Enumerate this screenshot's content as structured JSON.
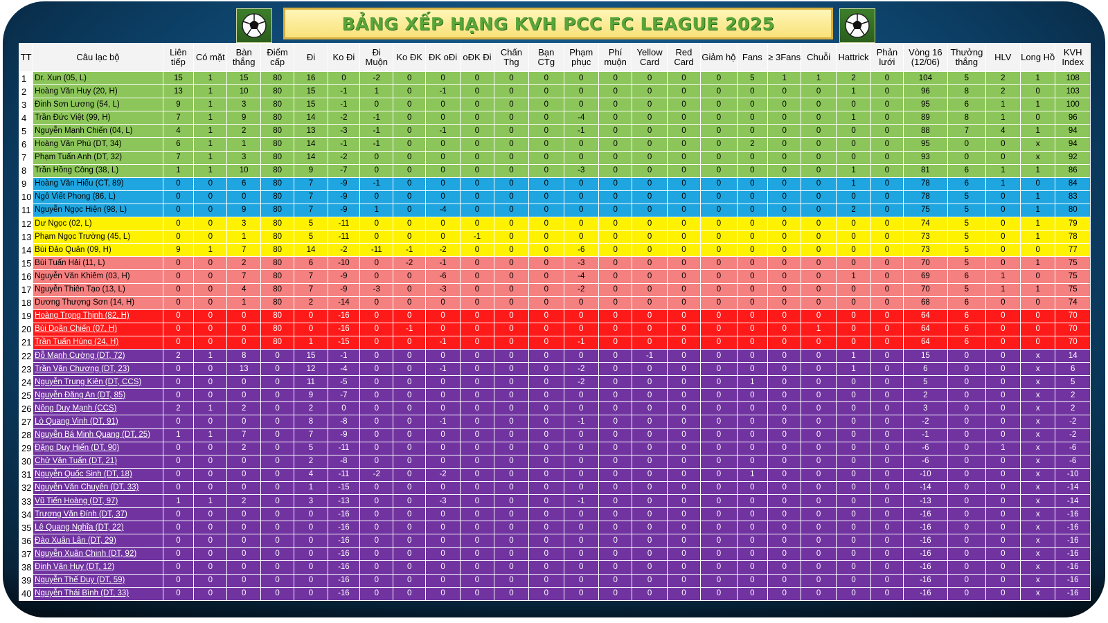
{
  "title": "BẢNG XẾP HẠNG KVH PCC FC LEAGUE 2025",
  "icons": {
    "left": "soccer-ball-icon",
    "right": "soccer-ball-icon"
  },
  "colors": {
    "green": "#8cc55a",
    "blue": "#1fa6e0",
    "yellow": "#fff200",
    "salmon": "#f58080",
    "red": "#ff1a1a",
    "purple": "#7033a0"
  },
  "headers": [
    "TT",
    "Câu lạc bộ",
    "Liên tiếp",
    "Có mặt",
    "Bàn thắng",
    "Điểm cấp",
    "Đi",
    "Ko Đi",
    "Đi Muộn",
    "Ko ĐK",
    "ĐK oĐi",
    "oĐK Đi",
    "Chấn Thg",
    "Bạn CTg",
    "Phạm phục",
    "Phí muộn",
    "Yellow Card",
    "Red Card",
    "Giảm hộ",
    "Fans",
    "≥ 3Fans",
    "Chuỗi",
    "Hattrick",
    "Phản lưới",
    "Vòng 16 (12/06)",
    "Thưởng thắng",
    "HLV",
    "Long Hồ",
    "KVH Index"
  ],
  "rows": [
    {
      "band": "g",
      "cells": [
        "1",
        "Dr. Xun (05, L)",
        "15",
        "1",
        "15",
        "80",
        "16",
        "0",
        "-2",
        "0",
        "0",
        "0",
        "0",
        "0",
        "0",
        "0",
        "0",
        "0",
        "0",
        "5",
        "1",
        "1",
        "2",
        "0",
        "104",
        "5",
        "2",
        "1",
        "108"
      ]
    },
    {
      "band": "g",
      "cells": [
        "2",
        "Hoàng Văn Huy (20, H)",
        "13",
        "1",
        "10",
        "80",
        "15",
        "-1",
        "1",
        "0",
        "-1",
        "0",
        "0",
        "0",
        "0",
        "0",
        "0",
        "0",
        "0",
        "0",
        "0",
        "0",
        "1",
        "0",
        "96",
        "8",
        "2",
        "0",
        "103"
      ]
    },
    {
      "band": "g",
      "cells": [
        "3",
        "Đinh Sơn Lương (54, L)",
        "9",
        "1",
        "3",
        "80",
        "15",
        "-1",
        "0",
        "0",
        "0",
        "0",
        "0",
        "0",
        "0",
        "0",
        "0",
        "0",
        "0",
        "0",
        "0",
        "0",
        "0",
        "0",
        "95",
        "6",
        "1",
        "1",
        "100"
      ]
    },
    {
      "band": "g",
      "cells": [
        "4",
        "Trần Đức Việt (99, H)",
        "7",
        "1",
        "9",
        "80",
        "14",
        "-2",
        "-1",
        "0",
        "0",
        "0",
        "0",
        "0",
        "-4",
        "0",
        "0",
        "0",
        "0",
        "0",
        "0",
        "0",
        "1",
        "0",
        "89",
        "8",
        "1",
        "0",
        "96"
      ]
    },
    {
      "band": "g",
      "cells": [
        "5",
        "Nguyễn Mạnh Chiến (04, L)",
        "4",
        "1",
        "2",
        "80",
        "13",
        "-3",
        "-1",
        "0",
        "-1",
        "0",
        "0",
        "0",
        "-1",
        "0",
        "0",
        "0",
        "0",
        "0",
        "0",
        "0",
        "0",
        "0",
        "88",
        "7",
        "4",
        "1",
        "94"
      ]
    },
    {
      "band": "g",
      "cells": [
        "6",
        "Hoàng Văn Phú (DT, 34)",
        "6",
        "1",
        "1",
        "80",
        "14",
        "-1",
        "-1",
        "0",
        "0",
        "0",
        "0",
        "0",
        "0",
        "0",
        "0",
        "0",
        "0",
        "2",
        "0",
        "0",
        "0",
        "0",
        "95",
        "0",
        "0",
        "x",
        "94"
      ]
    },
    {
      "band": "g",
      "cells": [
        "7",
        "Phạm Tuấn Anh (DT, 32)",
        "7",
        "1",
        "3",
        "80",
        "14",
        "-2",
        "0",
        "0",
        "0",
        "0",
        "0",
        "0",
        "0",
        "0",
        "0",
        "0",
        "0",
        "0",
        "0",
        "0",
        "0",
        "0",
        "93",
        "0",
        "0",
        "x",
        "92"
      ]
    },
    {
      "band": "g",
      "cells": [
        "8",
        "Trần Hồng Công (38, L)",
        "1",
        "1",
        "10",
        "80",
        "9",
        "-7",
        "0",
        "0",
        "0",
        "0",
        "0",
        "0",
        "-3",
        "0",
        "0",
        "0",
        "0",
        "0",
        "0",
        "0",
        "1",
        "0",
        "81",
        "6",
        "1",
        "1",
        "86"
      ]
    },
    {
      "band": "b",
      "cells": [
        "9",
        "Hoàng Văn Hiếu (CT, 89)",
        "0",
        "0",
        "6",
        "80",
        "7",
        "-9",
        "-1",
        "0",
        "0",
        "0",
        "0",
        "0",
        "0",
        "0",
        "0",
        "0",
        "0",
        "0",
        "0",
        "0",
        "1",
        "0",
        "78",
        "6",
        "1",
        "0",
        "84"
      ]
    },
    {
      "band": "b",
      "cells": [
        "10",
        "Ngô Viết Phong (86, L)",
        "0",
        "0",
        "0",
        "80",
        "7",
        "-9",
        "0",
        "0",
        "0",
        "0",
        "0",
        "0",
        "0",
        "0",
        "0",
        "0",
        "0",
        "0",
        "0",
        "0",
        "0",
        "0",
        "78",
        "5",
        "0",
        "1",
        "83"
      ]
    },
    {
      "band": "b",
      "cells": [
        "11",
        "Nguyễn Ngọc Hiện (98, L)",
        "0",
        "0",
        "9",
        "80",
        "7",
        "-9",
        "1",
        "0",
        "-4",
        "0",
        "0",
        "0",
        "0",
        "0",
        "0",
        "0",
        "0",
        "0",
        "0",
        "0",
        "2",
        "0",
        "75",
        "5",
        "0",
        "1",
        "80"
      ]
    },
    {
      "band": "y",
      "cells": [
        "12",
        "Dư Ngọc (02, L)",
        "0",
        "0",
        "3",
        "80",
        "5",
        "-11",
        "0",
        "0",
        "0",
        "0",
        "0",
        "0",
        "0",
        "0",
        "0",
        "0",
        "0",
        "0",
        "0",
        "0",
        "0",
        "0",
        "74",
        "5",
        "0",
        "1",
        "79"
      ]
    },
    {
      "band": "y",
      "cells": [
        "13",
        "Phạm Ngọc Trường (45, L)",
        "0",
        "0",
        "1",
        "80",
        "5",
        "-11",
        "0",
        "0",
        "0",
        "-1",
        "0",
        "0",
        "0",
        "0",
        "0",
        "0",
        "0",
        "0",
        "0",
        "0",
        "0",
        "0",
        "73",
        "5",
        "0",
        "1",
        "78"
      ]
    },
    {
      "band": "y",
      "cells": [
        "14",
        "Bùi Đảo Quân (09, H)",
        "9",
        "1",
        "7",
        "80",
        "14",
        "-2",
        "-11",
        "-1",
        "-2",
        "0",
        "0",
        "0",
        "-6",
        "0",
        "0",
        "0",
        "0",
        "0",
        "0",
        "0",
        "0",
        "0",
        "73",
        "5",
        "0",
        "0",
        "77"
      ]
    },
    {
      "band": "s",
      "cells": [
        "15",
        "Bùi Tuấn Hải (11, L)",
        "0",
        "0",
        "2",
        "80",
        "6",
        "-10",
        "0",
        "-2",
        "-1",
        "0",
        "0",
        "0",
        "-3",
        "0",
        "0",
        "0",
        "0",
        "0",
        "0",
        "0",
        "0",
        "0",
        "70",
        "5",
        "0",
        "1",
        "75"
      ]
    },
    {
      "band": "s",
      "cells": [
        "16",
        "Nguyễn Văn Khiêm (03, H)",
        "0",
        "0",
        "7",
        "80",
        "7",
        "-9",
        "0",
        "0",
        "-6",
        "0",
        "0",
        "0",
        "-4",
        "0",
        "0",
        "0",
        "0",
        "0",
        "0",
        "0",
        "1",
        "0",
        "69",
        "6",
        "1",
        "0",
        "75"
      ]
    },
    {
      "band": "s",
      "cells": [
        "17",
        "Nguyễn Thiên Tạo (13, L)",
        "0",
        "0",
        "4",
        "80",
        "7",
        "-9",
        "-3",
        "0",
        "-3",
        "0",
        "0",
        "0",
        "-2",
        "0",
        "0",
        "0",
        "0",
        "0",
        "0",
        "0",
        "0",
        "0",
        "70",
        "5",
        "1",
        "1",
        "75"
      ]
    },
    {
      "band": "s",
      "cells": [
        "18",
        "Dương Thượng Sơn (14, H)",
        "0",
        "0",
        "1",
        "80",
        "2",
        "-14",
        "0",
        "0",
        "0",
        "0",
        "0",
        "0",
        "0",
        "0",
        "0",
        "0",
        "0",
        "0",
        "0",
        "0",
        "0",
        "0",
        "68",
        "6",
        "0",
        "0",
        "74"
      ]
    },
    {
      "band": "r",
      "cells": [
        "19",
        "Hoàng Trọng Thịnh (82, H)",
        "0",
        "0",
        "0",
        "80",
        "0",
        "-16",
        "0",
        "0",
        "0",
        "0",
        "0",
        "0",
        "0",
        "0",
        "0",
        "0",
        "0",
        "0",
        "0",
        "0",
        "0",
        "0",
        "64",
        "6",
        "0",
        "0",
        "70"
      ]
    },
    {
      "band": "r",
      "cells": [
        "20",
        "Bùi Doãn Chiến (07, H)",
        "0",
        "0",
        "0",
        "80",
        "0",
        "-16",
        "0",
        "-1",
        "0",
        "0",
        "0",
        "0",
        "0",
        "0",
        "0",
        "0",
        "0",
        "0",
        "0",
        "1",
        "0",
        "0",
        "64",
        "6",
        "0",
        "0",
        "70"
      ]
    },
    {
      "band": "r",
      "cells": [
        "21",
        "Trần Tuấn Hùng (24, H)",
        "0",
        "0",
        "0",
        "80",
        "1",
        "-15",
        "0",
        "0",
        "-1",
        "0",
        "0",
        "0",
        "-1",
        "0",
        "0",
        "0",
        "0",
        "0",
        "0",
        "0",
        "0",
        "0",
        "64",
        "6",
        "0",
        "0",
        "70"
      ]
    },
    {
      "band": "p",
      "cells": [
        "22",
        "Đỗ Mạnh Cường (DT, 72)",
        "2",
        "1",
        "8",
        "0",
        "15",
        "-1",
        "0",
        "0",
        "0",
        "0",
        "0",
        "0",
        "0",
        "0",
        "-1",
        "0",
        "0",
        "0",
        "0",
        "0",
        "1",
        "0",
        "15",
        "0",
        "0",
        "x",
        "14"
      ]
    },
    {
      "band": "p",
      "cells": [
        "23",
        "Trần Văn Chương (DT, 23)",
        "0",
        "0",
        "13",
        "0",
        "12",
        "-4",
        "0",
        "0",
        "-1",
        "0",
        "0",
        "0",
        "-2",
        "0",
        "0",
        "0",
        "0",
        "0",
        "0",
        "0",
        "1",
        "0",
        "6",
        "0",
        "0",
        "x",
        "6"
      ]
    },
    {
      "band": "p",
      "cells": [
        "24",
        "Nguyễn Trung Kiên (DT, CCS)",
        "0",
        "0",
        "0",
        "0",
        "11",
        "-5",
        "0",
        "0",
        "0",
        "0",
        "0",
        "0",
        "-2",
        "0",
        "0",
        "0",
        "0",
        "1",
        "0",
        "0",
        "0",
        "0",
        "5",
        "0",
        "0",
        "x",
        "5"
      ]
    },
    {
      "band": "p",
      "cells": [
        "25",
        "Nguyễn Đăng An (DT, 85)",
        "0",
        "0",
        "0",
        "0",
        "9",
        "-7",
        "0",
        "0",
        "0",
        "0",
        "0",
        "0",
        "0",
        "0",
        "0",
        "0",
        "0",
        "0",
        "0",
        "0",
        "0",
        "0",
        "2",
        "0",
        "0",
        "x",
        "2"
      ]
    },
    {
      "band": "p",
      "cells": [
        "26",
        "Nông Duy Mạnh (CCS)",
        "2",
        "1",
        "2",
        "0",
        "2",
        "0",
        "0",
        "0",
        "0",
        "0",
        "0",
        "0",
        "0",
        "0",
        "0",
        "0",
        "0",
        "0",
        "0",
        "0",
        "0",
        "0",
        "3",
        "0",
        "0",
        "x",
        "2"
      ]
    },
    {
      "band": "p",
      "cells": [
        "27",
        "Lò Quang Vinh (DT, 91)",
        "0",
        "0",
        "0",
        "0",
        "8",
        "-8",
        "0",
        "0",
        "-1",
        "0",
        "0",
        "0",
        "-1",
        "0",
        "0",
        "0",
        "0",
        "0",
        "0",
        "0",
        "0",
        "0",
        "-2",
        "0",
        "0",
        "x",
        "-2"
      ]
    },
    {
      "band": "p",
      "cells": [
        "28",
        "Nguyễn Bá Minh Quang (DT, 25)",
        "1",
        "1",
        "7",
        "0",
        "7",
        "-9",
        "0",
        "0",
        "0",
        "0",
        "0",
        "0",
        "0",
        "0",
        "0",
        "0",
        "0",
        "0",
        "0",
        "0",
        "0",
        "0",
        "-1",
        "0",
        "0",
        "x",
        "-2"
      ]
    },
    {
      "band": "p",
      "cells": [
        "29",
        "Đặng Duy Hiển (DT, 90)",
        "0",
        "0",
        "2",
        "0",
        "5",
        "-11",
        "0",
        "0",
        "0",
        "0",
        "0",
        "0",
        "0",
        "0",
        "0",
        "0",
        "0",
        "0",
        "0",
        "0",
        "0",
        "0",
        "-6",
        "0",
        "1",
        "x",
        "-6"
      ]
    },
    {
      "band": "p",
      "cells": [
        "30",
        "Chử Văn Tuấn (DT, 21)",
        "0",
        "0",
        "0",
        "0",
        "2",
        "-8",
        "0",
        "0",
        "0",
        "0",
        "0",
        "0",
        "0",
        "0",
        "0",
        "0",
        "0",
        "0",
        "0",
        "0",
        "0",
        "0",
        "-6",
        "0",
        "0",
        "x",
        "-6"
      ]
    },
    {
      "band": "p",
      "cells": [
        "31",
        "Nguyễn Quốc Sinh (DT, 18)",
        "0",
        "0",
        "0",
        "0",
        "4",
        "-11",
        "-2",
        "0",
        "-2",
        "0",
        "0",
        "0",
        "0",
        "0",
        "0",
        "0",
        "0",
        "1",
        "0",
        "0",
        "0",
        "0",
        "-10",
        "0",
        "0",
        "x",
        "-10"
      ]
    },
    {
      "band": "p",
      "cells": [
        "32",
        "Nguyễn Văn Chuyên (DT, 33)",
        "0",
        "0",
        "0",
        "0",
        "1",
        "-15",
        "0",
        "0",
        "0",
        "0",
        "0",
        "0",
        "0",
        "0",
        "0",
        "0",
        "0",
        "0",
        "0",
        "0",
        "0",
        "0",
        "-14",
        "0",
        "0",
        "x",
        "-14"
      ]
    },
    {
      "band": "p",
      "cells": [
        "33",
        "Vũ Tiến Hoàng (DT, 97)",
        "1",
        "1",
        "2",
        "0",
        "3",
        "-13",
        "0",
        "0",
        "-3",
        "0",
        "0",
        "0",
        "-1",
        "0",
        "0",
        "0",
        "0",
        "0",
        "0",
        "0",
        "0",
        "0",
        "-13",
        "0",
        "0",
        "x",
        "-14"
      ]
    },
    {
      "band": "p",
      "cells": [
        "34",
        "Trương Văn Đính (DT, 37)",
        "0",
        "0",
        "0",
        "0",
        "0",
        "-16",
        "0",
        "0",
        "0",
        "0",
        "0",
        "0",
        "0",
        "0",
        "0",
        "0",
        "0",
        "0",
        "0",
        "0",
        "0",
        "0",
        "-16",
        "0",
        "0",
        "x",
        "-16"
      ]
    },
    {
      "band": "p",
      "cells": [
        "35",
        "Lê Quang Nghĩa (DT, 22)",
        "0",
        "0",
        "0",
        "0",
        "0",
        "-16",
        "0",
        "0",
        "0",
        "0",
        "0",
        "0",
        "0",
        "0",
        "0",
        "0",
        "0",
        "0",
        "0",
        "0",
        "0",
        "0",
        "-16",
        "0",
        "0",
        "x",
        "-16"
      ]
    },
    {
      "band": "p",
      "cells": [
        "36",
        "Đào Xuân Lân (DT, 29)",
        "0",
        "0",
        "0",
        "0",
        "0",
        "-16",
        "0",
        "0",
        "0",
        "0",
        "0",
        "0",
        "0",
        "0",
        "0",
        "0",
        "0",
        "0",
        "0",
        "0",
        "0",
        "0",
        "-16",
        "0",
        "0",
        "x",
        "-16"
      ]
    },
    {
      "band": "p",
      "cells": [
        "37",
        "Nguyễn Xuân Chinh (DT, 92)",
        "0",
        "0",
        "0",
        "0",
        "0",
        "-16",
        "0",
        "0",
        "0",
        "0",
        "0",
        "0",
        "0",
        "0",
        "0",
        "0",
        "0",
        "0",
        "0",
        "0",
        "0",
        "0",
        "-16",
        "0",
        "0",
        "x",
        "-16"
      ]
    },
    {
      "band": "p",
      "cells": [
        "38",
        "Đinh Văn Huy (DT, 12)",
        "0",
        "0",
        "0",
        "0",
        "0",
        "-16",
        "0",
        "0",
        "0",
        "0",
        "0",
        "0",
        "0",
        "0",
        "0",
        "0",
        "0",
        "0",
        "0",
        "0",
        "0",
        "0",
        "-16",
        "0",
        "0",
        "x",
        "-16"
      ]
    },
    {
      "band": "p",
      "cells": [
        "39",
        "Nguyễn Thế Duy (DT, 59)",
        "0",
        "0",
        "0",
        "0",
        "0",
        "-16",
        "0",
        "0",
        "0",
        "0",
        "0",
        "0",
        "0",
        "0",
        "0",
        "0",
        "0",
        "0",
        "0",
        "0",
        "0",
        "0",
        "-16",
        "0",
        "0",
        "x",
        "-16"
      ]
    },
    {
      "band": "p",
      "cells": [
        "40",
        "Nguyễn Thái Bình (DT, 33)",
        "0",
        "0",
        "0",
        "0",
        "0",
        "-16",
        "0",
        "0",
        "0",
        "0",
        "0",
        "0",
        "0",
        "0",
        "0",
        "0",
        "0",
        "0",
        "0",
        "0",
        "0",
        "0",
        "-16",
        "0",
        "0",
        "x",
        "-16"
      ]
    }
  ]
}
